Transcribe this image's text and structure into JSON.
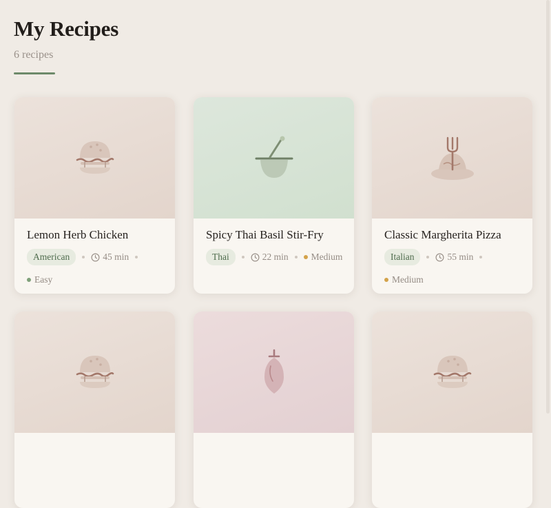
{
  "header": {
    "title": "My Recipes",
    "subtitle": "6 recipes"
  },
  "colors": {
    "accent": "#6d8a6a",
    "easy": "#7fa07a",
    "medium": "#d3a24a"
  },
  "recipes": [
    {
      "title": "Lemon Herb Chicken",
      "cuisine": "American",
      "time": "45 min",
      "difficulty": "Easy",
      "icon": "burger-icon",
      "tone": "beige"
    },
    {
      "title": "Spicy Thai Basil Stir-Fry",
      "cuisine": "Thai",
      "time": "22 min",
      "difficulty": "Medium",
      "icon": "wok-spatula-icon",
      "tone": "green"
    },
    {
      "title": "Classic Margherita Pizza",
      "cuisine": "Italian",
      "time": "55 min",
      "difficulty": "Medium",
      "icon": "fork-plate-icon",
      "tone": "beige"
    },
    {
      "icon": "burger-icon",
      "tone": "beige"
    },
    {
      "icon": "bottle-icon",
      "tone": "rose"
    },
    {
      "icon": "burger-icon",
      "tone": "beige"
    }
  ]
}
